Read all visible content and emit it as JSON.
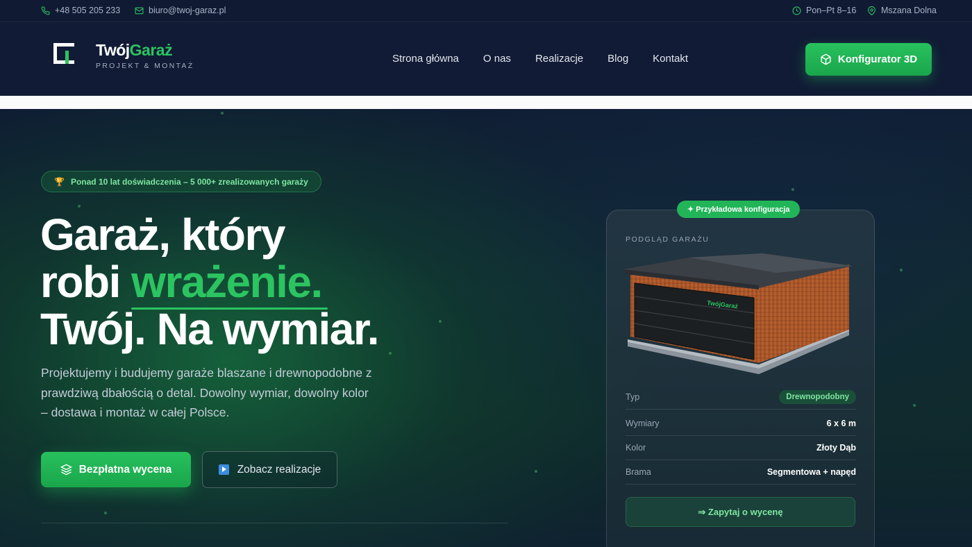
{
  "topbar": {
    "phone": "+48 505 205 233",
    "email": "biuro@twoj-garaz.pl",
    "hours": "Pon–Pt 8–16",
    "location": "Mszana Dolna"
  },
  "logo": {
    "brand_a": "Twój",
    "brand_b": "Garaż",
    "tagline": "PROJEKT & MONTAŻ"
  },
  "nav": {
    "items": [
      "Strona główna",
      "O nas",
      "Realizacje",
      "Blog",
      "Kontakt"
    ],
    "cta": "Konfigurator 3D"
  },
  "hero": {
    "badge": "Ponad 10 lat doświadczenia – 5 000+ zrealizowanych garaży",
    "headline_1": "Garaż, który",
    "headline_2a": "robi ",
    "headline_2b": "wrażenie.",
    "headline_3": "Twój. Na wymiar.",
    "lead": "Projektujemy i budujemy garaże blaszane i drewnopodobne z prawdziwą dbałością o detal. Dowolny wymiar, dowolny kolor – dostawa i montaż w całej Polsce.",
    "primary_btn": "Bezpłatna wycena",
    "secondary_btn": "Zobacz realizacje"
  },
  "card": {
    "tag": "✦ Przykładowa konfiguracja",
    "label": "PODGLĄD GARAŻU",
    "door_brand": "TwójGaraż",
    "specs": [
      {
        "key": "Typ",
        "value": "Drewnopodobny"
      },
      {
        "key": "Wymiary",
        "value": "6 x 6 m"
      },
      {
        "key": "Kolor",
        "value": "Złoty Dąb"
      },
      {
        "key": "Brama",
        "value": "Segmentowa + napęd"
      }
    ],
    "quote_btn": "⇒ Zapytaj o wycenę"
  },
  "colors": {
    "accent": "#22b558",
    "bg": "#111b35"
  }
}
